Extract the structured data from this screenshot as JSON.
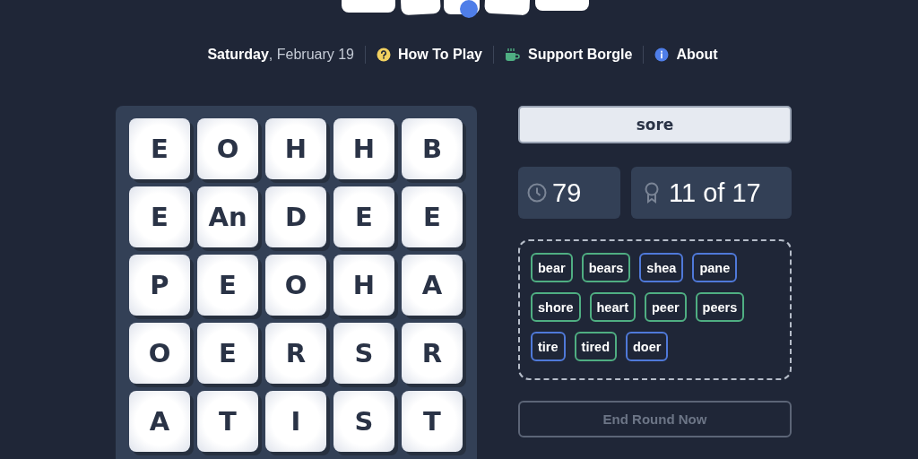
{
  "nav": {
    "day": "Saturday",
    "date": ", February 19",
    "links": [
      {
        "kind": "help",
        "label": "How To Play"
      },
      {
        "kind": "support",
        "label": "Support Borgle"
      },
      {
        "kind": "about",
        "label": "About"
      }
    ]
  },
  "board": [
    [
      "E",
      "O",
      "H",
      "H",
      "B"
    ],
    [
      "E",
      "An",
      "D",
      "E",
      "E"
    ],
    [
      "P",
      "E",
      "O",
      "H",
      "A"
    ],
    [
      "O",
      "E",
      "R",
      "S",
      "R"
    ],
    [
      "A",
      "T",
      "I",
      "S",
      "T"
    ]
  ],
  "current_word": "sore",
  "timer": "79",
  "progress": "11 of 17",
  "words": [
    {
      "text": "bear",
      "color": "#4fae82"
    },
    {
      "text": "bears",
      "color": "#4fae82"
    },
    {
      "text": "shea",
      "color": "#4f79d9"
    },
    {
      "text": "pane",
      "color": "#4f79d9"
    },
    {
      "text": "shore",
      "color": "#4fae82"
    },
    {
      "text": "heart",
      "color": "#4fae82"
    },
    {
      "text": "peer",
      "color": "#4fae82"
    },
    {
      "text": "peers",
      "color": "#4fae82"
    },
    {
      "text": "tire",
      "color": "#4f79d9"
    },
    {
      "text": "tired",
      "color": "#4fae82"
    },
    {
      "text": "doer",
      "color": "#4f79d9"
    }
  ],
  "end_button": "End Round Now"
}
